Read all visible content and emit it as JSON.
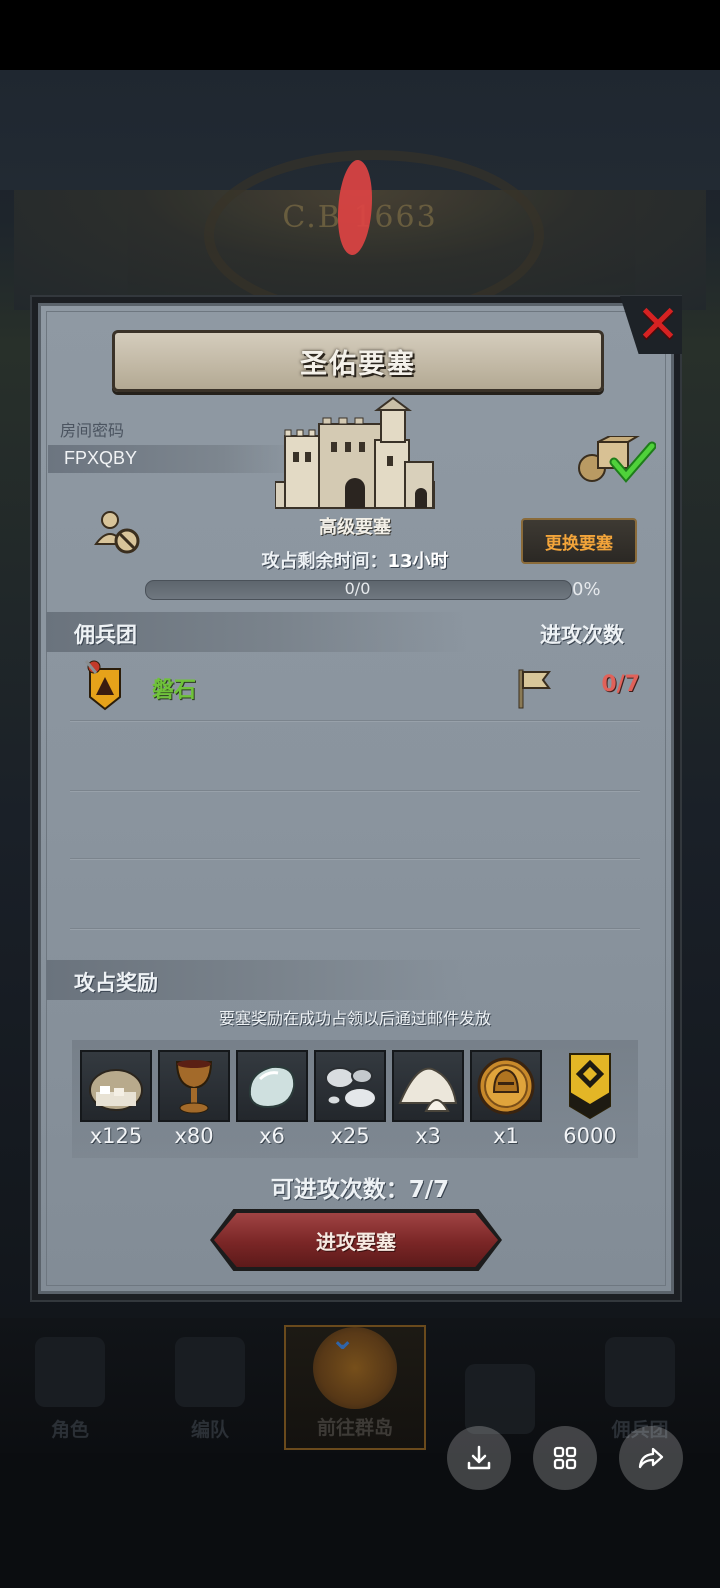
{
  "title": "圣佑要塞",
  "room": {
    "label": "房间密码",
    "code": "FPXQBY"
  },
  "fortress": {
    "type": "高级要塞",
    "change_button": "更换要塞",
    "remaining_time_label": "攻占剩余时间：",
    "remaining_time_value": "13小时",
    "progress_text": "0/0",
    "progress_percent": "0%",
    "progress_fraction": 0
  },
  "mercenary": {
    "section_title": "佣兵团",
    "attacks_header": "进攻次数",
    "rows": [
      {
        "name": "磐石",
        "attacks": "0/7"
      }
    ]
  },
  "rewards": {
    "section_title": "攻占奖励",
    "note": "要塞奖励在成功占领以后通过邮件发放",
    "items": [
      {
        "icon": "sack-icon",
        "qty": "x125"
      },
      {
        "icon": "goblet-icon",
        "qty": "x80"
      },
      {
        "icon": "stone-icon",
        "qty": "x6"
      },
      {
        "icon": "silver-ore-icon",
        "qty": "x25"
      },
      {
        "icon": "salt-pile-icon",
        "qty": "x3"
      },
      {
        "icon": "gold-helmet-coin-icon",
        "qty": "x1"
      },
      {
        "icon": "rank-badge-icon",
        "qty": "6000"
      }
    ]
  },
  "attack": {
    "remaining_label": "可进攻次数：",
    "remaining_value": "7/7",
    "button": "进攻要塞"
  },
  "background_year": "C.B 1663",
  "bottom_nav": [
    {
      "label": "角色"
    },
    {
      "label": "编队"
    },
    {
      "label": "前往群岛"
    },
    {
      "label": ""
    },
    {
      "label": "佣兵团"
    }
  ],
  "colors": {
    "accent_orange": "#f2a43a",
    "merc_green": "#6fc23a",
    "count_red": "#e0625a",
    "close_red": "#d62222"
  }
}
